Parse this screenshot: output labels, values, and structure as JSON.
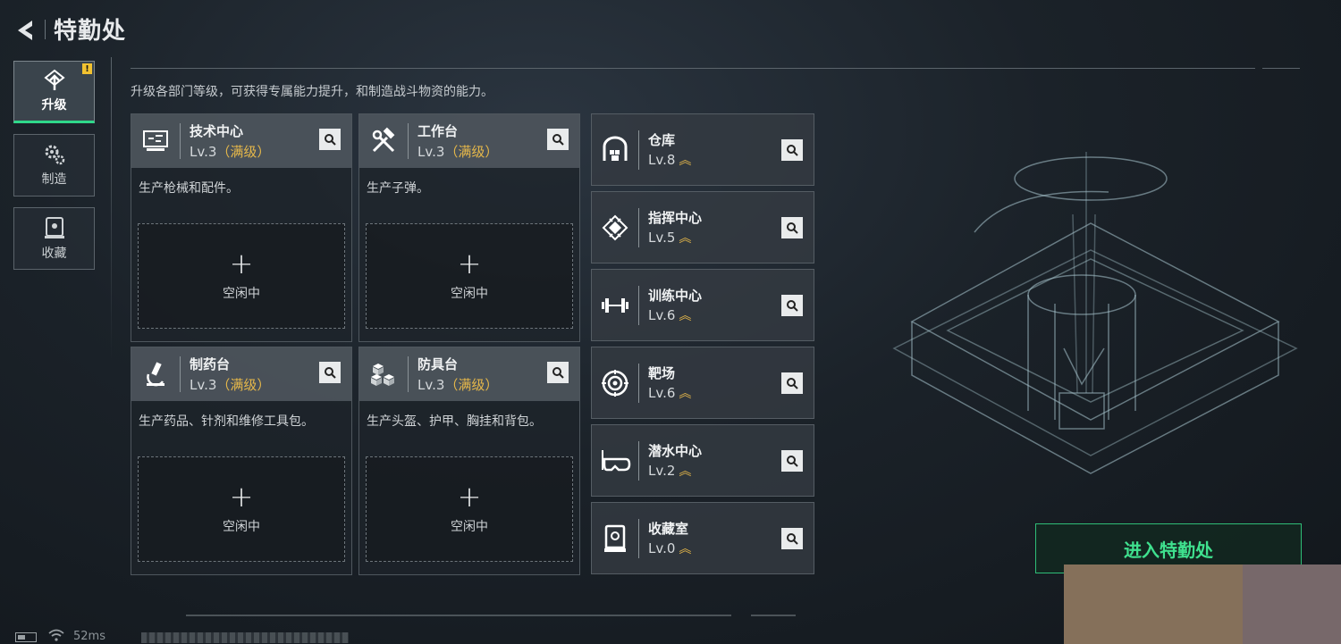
{
  "header": {
    "title": "特勤处",
    "back_icon": "back-arrow-icon"
  },
  "nav": {
    "items": [
      {
        "label": "升级",
        "icon": "upgrade-icon",
        "active": true,
        "badge": "!"
      },
      {
        "label": "制造",
        "icon": "gear-cluster-icon",
        "active": false
      },
      {
        "label": "收藏",
        "icon": "collection-icon",
        "active": false
      }
    ]
  },
  "description": "升级各部门等级，可获得专属能力提升，和制造战斗物资的能力。",
  "cards": [
    {
      "name": "技术中心",
      "level": "Lv.3",
      "max": "（满级）",
      "text": "生产枪械和配件。",
      "idle": "空闲中",
      "icon": "monitor-icon"
    },
    {
      "name": "工作台",
      "level": "Lv.3",
      "max": "（满级）",
      "text": "生产子弹。",
      "idle": "空闲中",
      "icon": "hammer-wrench-icon"
    },
    {
      "name": "制药台",
      "level": "Lv.3",
      "max": "（满级）",
      "text": "生产药品、针剂和维修工具包。",
      "idle": "空闲中",
      "icon": "microscope-icon"
    },
    {
      "name": "防具台",
      "level": "Lv.3",
      "max": "（满级）",
      "text": "生产头盔、护甲、胸挂和背包。",
      "idle": "空闲中",
      "icon": "cubes-icon"
    }
  ],
  "facilities": [
    {
      "name": "仓库",
      "level": "Lv.8",
      "icon": "warehouse-icon"
    },
    {
      "name": "指挥中心",
      "level": "Lv.5",
      "icon": "chip-icon"
    },
    {
      "name": "训练中心",
      "level": "Lv.6",
      "icon": "dumbbell-icon"
    },
    {
      "name": "靶场",
      "level": "Lv.6",
      "icon": "target-icon"
    },
    {
      "name": "潜水中心",
      "level": "Lv.2",
      "icon": "diving-mask-icon"
    },
    {
      "name": "收藏室",
      "level": "Lv.0",
      "icon": "display-case-icon"
    }
  ],
  "enter_button": "进入特勤处",
  "status": {
    "ping": "52ms"
  },
  "colors": {
    "accent_green": "#2fd88a",
    "max_gold": "#e6b84a"
  }
}
